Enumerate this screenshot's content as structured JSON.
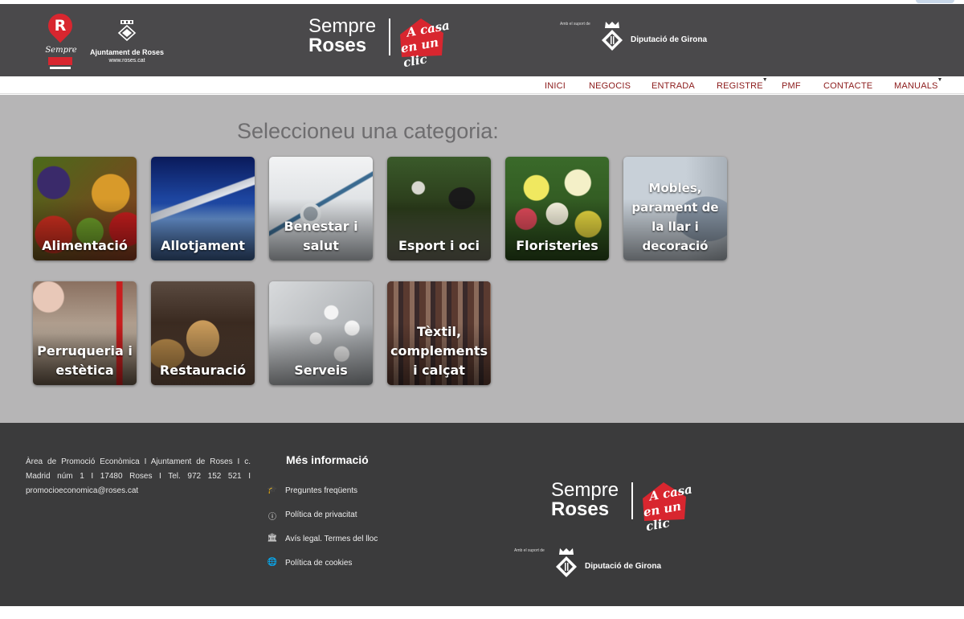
{
  "header": {
    "r_logo_text": "Sempre",
    "r_logo_letter": "R",
    "ajuntament_name": "Ajuntament de Roses",
    "ajuntament_web": "www.roses.cat",
    "brand_sempre": "Sempre",
    "brand_roses": "Roses",
    "brand_casa_line1": "A casa",
    "brand_casa_line2": "en un clic",
    "support_text": "Amb el suport de",
    "diputacio_name": "Diputació de Girona"
  },
  "nav": {
    "items": [
      {
        "label": "INICI"
      },
      {
        "label": "NEGOCIS"
      },
      {
        "label": "ENTRADA"
      },
      {
        "label": "REGISTRE"
      },
      {
        "label": "PMF"
      },
      {
        "label": "CONTACTE"
      },
      {
        "label": "MANUALS"
      }
    ]
  },
  "main": {
    "heading": "Seleccioneu una categoria:",
    "categories": [
      {
        "label": "Alimentació"
      },
      {
        "label": "Allotjament"
      },
      {
        "label": "Benestar i salut"
      },
      {
        "label": "Esport i oci"
      },
      {
        "label": "Floristeries"
      },
      {
        "label": "Mobles, parament de la llar i decoració"
      },
      {
        "label": "Perruqueria i estètica"
      },
      {
        "label": "Restauració"
      },
      {
        "label": "Serveis"
      },
      {
        "label": "Tèxtil, complements i calçat"
      }
    ]
  },
  "footer": {
    "address": "Àrea de Promoció Econòmica I Ajuntament de Roses I c. Madrid núm 1 I 17480 Roses I Tel. 972 152 521 I promocioeconomica@roses.cat",
    "more_title": "Més informació",
    "links": [
      {
        "label": "Preguntes freqüents",
        "icon": "graduation-cap-icon"
      },
      {
        "label": "Política de privacitat",
        "icon": "info-icon"
      },
      {
        "label": "Avís legal. Termes del lloc",
        "icon": "bank-icon"
      },
      {
        "label": "Política de cookies",
        "icon": "globe-icon"
      }
    ],
    "brand_sempre": "Sempre",
    "brand_roses": "Roses",
    "brand_casa_line1": "A casa",
    "brand_casa_line2": "en un clic",
    "support_text": "Amb el suport de",
    "diputacio_name": "Diputació de Girona"
  },
  "colors": {
    "header_bg": "#4a494b",
    "nav_text": "#8b1a1a",
    "main_bg": "#b6b5b6",
    "footer_bg": "#3b3b3c",
    "brand_red": "#d8262f"
  }
}
